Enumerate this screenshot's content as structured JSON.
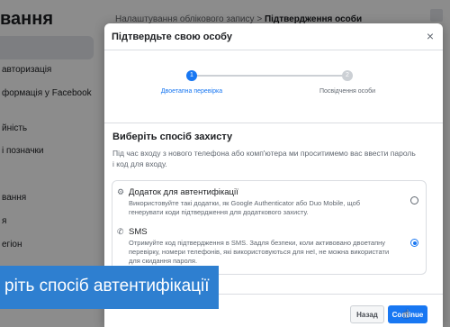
{
  "background": {
    "sidebar_title": "вання",
    "sidebar_items": [
      "авторизація",
      "формація у Facebook",
      "йність",
      "і позначки",
      "вання",
      "я",
      "егіон"
    ],
    "breadcrumb_parent": "Налаштування облікового запису",
    "breadcrumb_separator": ">",
    "breadcrumb_current": "Підтвердження особи",
    "side_fragments": [
      "е",
      "н"
    ]
  },
  "modal": {
    "title": "Підтвердьте свою особу",
    "close_glyph": "×",
    "steps": [
      {
        "number": "1",
        "label": "Двоетапна перевірка",
        "active": true
      },
      {
        "number": "2",
        "label": "Посвідчення особи",
        "active": false
      }
    ],
    "section_title": "Виберіть спосіб захисту",
    "section_description": "Під час входу з нового телефона або комп'ютера ми проситимемо вас ввести пароль і код для входу.",
    "options": [
      {
        "icon": "gear-icon",
        "icon_glyph": "⚙",
        "title": "Додаток для автентифікації",
        "description": "Використовуйте такі додатки, як Google Authenticator або Duo Mobile, щоб генерувати коди підтвердження для додаткового захисту.",
        "selected": false
      },
      {
        "icon": "phone-message-icon",
        "icon_glyph": "✆",
        "title": "SMS",
        "description": "Отримуйте код підтвердження в SMS. Задля безпеки, коли активовано двоетапну перевірку, номери телефонів, які використовуються для неї, не можна використати для скидання пароля.",
        "selected": true
      }
    ],
    "back_label": "Назад",
    "continue_label": "Continue"
  },
  "caption": {
    "text": "ріть спосіб автентифікації"
  },
  "colors": {
    "accent": "#1877f2",
    "caption_bg": "#2e7fd0"
  }
}
